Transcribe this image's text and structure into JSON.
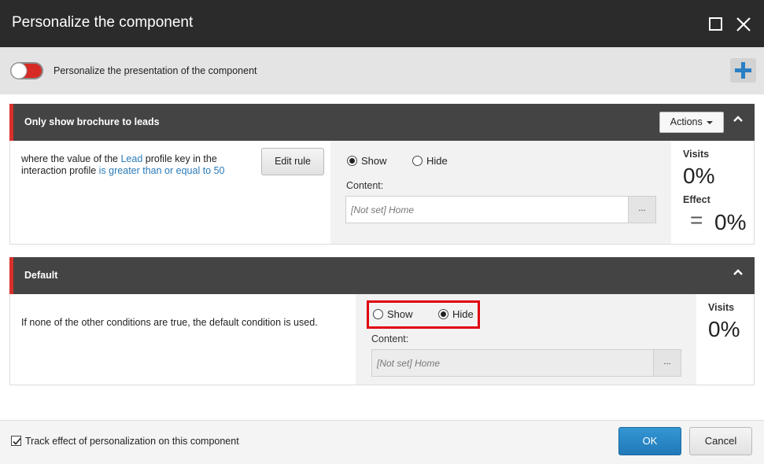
{
  "dialog": {
    "title": "Personalize the component"
  },
  "toolbar": {
    "toggle_label": "Personalize the presentation of the component"
  },
  "rules": [
    {
      "name": "Only show brochure to leads",
      "actions_label": "Actions",
      "condition": {
        "part1": "where the value of the ",
        "link1": "Lead",
        "part2": " profile key in the interaction profile ",
        "link2": "is greater than or equal to 50"
      },
      "edit_rule_label": "Edit rule",
      "show_label": "Show",
      "hide_label": "Hide",
      "selected": "Show",
      "content_label": "Content:",
      "content_placeholder": "[Not set] Home",
      "browse_label": "...",
      "visits_label": "Visits",
      "visits_value": "0%",
      "effect_label": "Effect",
      "effect_symbol": "=",
      "effect_value": "0%"
    },
    {
      "name": "Default",
      "condition_text": "If none of the other conditions are true, the default condition is used.",
      "show_label": "Show",
      "hide_label": "Hide",
      "selected": "Hide",
      "content_label": "Content:",
      "content_placeholder": "[Not set] Home",
      "browse_label": "...",
      "visits_label": "Visits",
      "visits_value": "0%"
    }
  ],
  "footer": {
    "track_label": "Track effect of personalization on this component",
    "track_checked": true,
    "ok_label": "OK",
    "cancel_label": "Cancel"
  },
  "colors": {
    "titlebar": "#2b2b2b",
    "rule_header": "#444444",
    "rule_accent": "#d9302a",
    "primary_button": "#2a86c5",
    "add_icon": "#2a7fc4",
    "highlight": "#e0000f"
  }
}
